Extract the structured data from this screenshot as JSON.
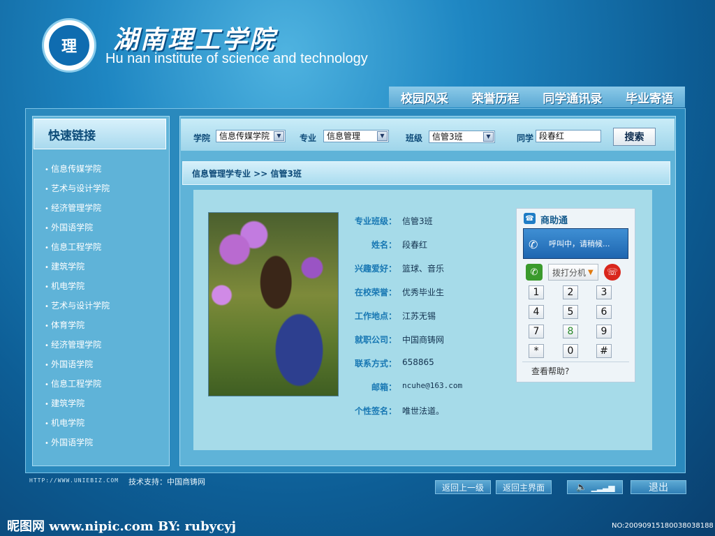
{
  "header": {
    "school_cn": "湖南理工学院",
    "school_en": "Hu nan institute of science and technology",
    "logo_text": "理"
  },
  "top_nav": [
    "校园风采",
    "荣誉历程",
    "同学通讯录",
    "毕业寄语"
  ],
  "sidebar": {
    "title": "快速链接",
    "items": [
      "信息传媒学院",
      "艺术与设计学院",
      "经济管理学院",
      "外国语学院",
      "信息工程学院",
      "建筑学院",
      "机电学院",
      "艺术与设计学院",
      "体育学院",
      "经济管理学院",
      "外国语学院",
      "信息工程学院",
      "建筑学院",
      "机电学院",
      "外国语学院"
    ]
  },
  "filter": {
    "college_label": "学院",
    "college_value": "信息传媒学院",
    "major_label": "专业",
    "major_value": "信息管理",
    "class_label": "班级",
    "class_value": "信管3班",
    "classmate_label": "同学",
    "classmate_value": "段春红",
    "search_label": "搜索"
  },
  "breadcrumb": "信息管理学专业 >> 信管3班",
  "profile": [
    {
      "label": "专业班级：",
      "value": "信管3班"
    },
    {
      "label": "姓名：",
      "value": "段春红"
    },
    {
      "label": "兴趣爱好：",
      "value": "篮球、音乐"
    },
    {
      "label": "在校荣誉：",
      "value": "优秀毕业生"
    },
    {
      "label": "工作地点：",
      "value": "江苏无锡"
    },
    {
      "label": "就职公司：",
      "value": "中国商铸网"
    },
    {
      "label": "联系方式：",
      "value": "658865"
    },
    {
      "label": "邮箱：",
      "value": "ncuhe@163.com"
    },
    {
      "label": "个性签名：",
      "value": "唯世法道。"
    }
  ],
  "phone": {
    "title": "商助通",
    "status": "呼叫中，请稍候...",
    "ext_placeholder": "拨打分机",
    "keys": [
      "1",
      "2",
      "3",
      "4",
      "5",
      "6",
      "7",
      "8",
      "9",
      "*",
      "0",
      "#"
    ],
    "help": "查看帮助?"
  },
  "footer": {
    "url": "HTTP://WWW.UNIEBIZ.COM",
    "tech": "技术支持：中国商铸网",
    "back": "返回上一级",
    "home": "返回主界面",
    "exit": "退出"
  },
  "watermark": {
    "text": "昵图网 www.nipic.com  BY: rubycyj",
    "id": "NO:20090915180038038188"
  },
  "colors": {
    "accent": "#1777b3",
    "frame": "#2a89bd",
    "panel": "#5fb3d8",
    "content": "#a6dbe9"
  }
}
